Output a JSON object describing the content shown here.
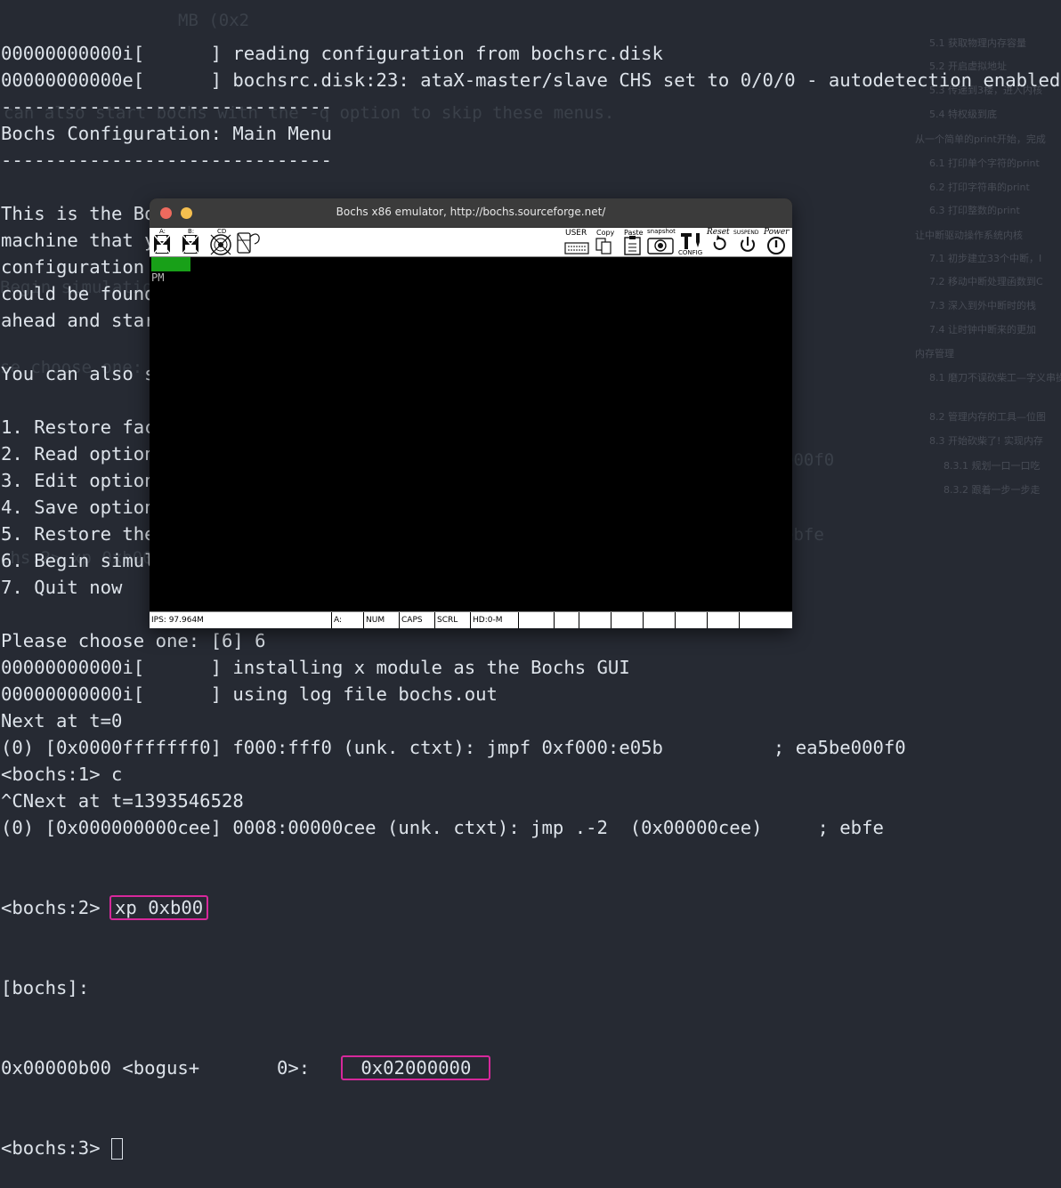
{
  "terminal": {
    "lines": [
      "00000000000i[      ] reading configuration from bochsrc.disk",
      "00000000000e[      ] bochsrc.disk:23: ataX-master/slave CHS set to 0/0/0 - autodetection enabled",
      "------------------------------",
      "Bochs Configuration: Main Menu",
      "------------------------------",
      "",
      "This is the Bochs Configuration Interface, where you can describe the",
      "machine that you want to simulate.  Bochs has already searched for a",
      "configuration file (typically called bochsrc.txt) and loaded it if it",
      "could be found.  When you are satisfied with the configuration, go",
      "ahead and start the simulation.",
      "",
      "You can also start bochs with the -q option to skip these menus.",
      "",
      "1. Restore factory default configuration",
      "2. Read options from...",
      "3. Edit options",
      "4. Save options to...",
      "5. Restore the Bochs state from...",
      "6. Begin simulation",
      "7. Quit now",
      "",
      "Please choose one: [6] 6",
      "00000000000i[      ] installing x module as the Bochs GUI",
      "00000000000i[      ] using log file bochs.out",
      "Next at t=0",
      "(0) [0x0000fffffff0] f000:fff0 (unk. ctxt): jmpf 0xf000:e05b          ; ea5be000f0",
      "<bochs:1> c",
      "^CNext at t=1393546528",
      "(0) [0x000000000cee] 0008:00000cee (unk. ctxt): jmp .-2  (0x00000cee)     ; ebfe"
    ],
    "cmd_prompt": "<bochs:2> ",
    "cmd_text": "xp 0xb00",
    "bochs_label": "[bochs]:",
    "mem_prefix": "0x00000b00 <bogus+       0>:   ",
    "mem_value": "0x02000000",
    "final_prompt": "<bochs:3> "
  },
  "background": {
    "sidebar_items": [
      "5.1 获取物理内存容量",
      "5.2 开启虚拟地址",
      "5.3 传递到3楼，进入内核",
      "5.4 特权级到底",
      "从一个简单的print开始，完成",
      "6.1 打印单个字符的print",
      "6.2 打印字符串的print",
      "6.3 打印整数的print",
      "让中断驱动操作系统内核",
      "7.1 初步建立33个中断，I",
      "7.2 移动中断处理函数到C",
      "7.3 深入到外中断时的栈",
      "7.4 让时钟中断来的更加",
      "内存管理",
      "8.1 磨刀不误砍柴工—字义串操作函数",
      "8.2 管理内存的工具—位图",
      "8.3 开始砍柴了! 实现内存",
      "8.3.1 规划一口一口吃",
      "8.3.2 跟着一步一步走"
    ],
    "ghost_texts": [
      "MB (0x2",
      "can also start bochs with the -q option to skip these menus.",
      "Begin simulation",
      "se choose one:",
      "000f0",
      "ebfe",
      "chs:2> xp 0xb00"
    ]
  },
  "bochs_window": {
    "title": "Bochs x86 emulator, http://bochs.sourceforge.net/",
    "buttons": {
      "close_color": "#ed6a5e",
      "minimize_color": "#f5bf4f"
    },
    "toolbar": {
      "floppy_a": "A:",
      "floppy_b": "B:",
      "cdrom": "CD",
      "user": "USER",
      "copy": "Copy",
      "paste": "Paste",
      "snapshot": "snapshot",
      "config": "CONFIG",
      "reset": "Reset",
      "suspend": "SUSPEND",
      "power": "Power"
    },
    "screen": {
      "text": "PM",
      "indicator_color": "#18a018"
    },
    "status": {
      "ips": "IPS: 97.964M",
      "drive": "A:",
      "num": "NUM",
      "caps": "CAPS",
      "scrl": "SCRL",
      "hd": "HD:0-M"
    }
  },
  "colors": {
    "terminal_bg": "#262a33",
    "terminal_fg": "#dde3ea",
    "highlight": "#d6289b"
  }
}
